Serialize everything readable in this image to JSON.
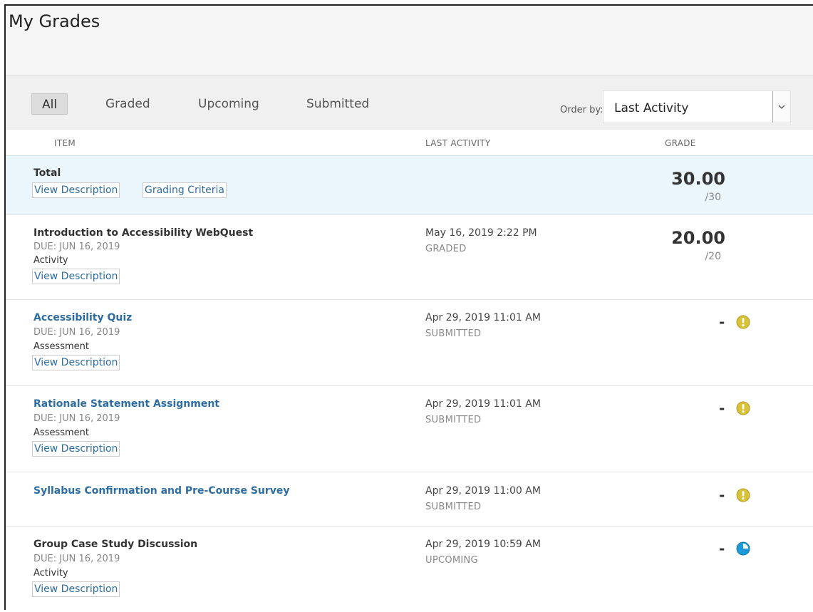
{
  "page": {
    "title": "My Grades"
  },
  "filters": {
    "all": "All",
    "graded": "Graded",
    "upcoming": "Upcoming",
    "submitted": "Submitted",
    "active": "All"
  },
  "order": {
    "label": "Order by:",
    "value": "Last Activity"
  },
  "columns": {
    "item": "ITEM",
    "last_activity": "LAST ACTIVITY",
    "grade": "GRADE"
  },
  "total": {
    "title": "Total",
    "view_description": "View Description",
    "grading_criteria": "Grading Criteria",
    "grade": "30.00",
    "points": "/30"
  },
  "items": [
    {
      "title": "Introduction to Accessibility WebQuest",
      "due": "DUE: JUN 16, 2019",
      "type": "Activity",
      "view_description": "View Description",
      "activity_date": "May 16, 2019 2:22 PM",
      "activity_status": "GRADED",
      "grade": "20.00",
      "points": "/20"
    },
    {
      "title": "Accessibility Quiz",
      "due": "DUE: JUN 16, 2019",
      "type": "Assessment",
      "view_description": "View Description",
      "activity_date": "Apr 29, 2019 11:01 AM",
      "activity_status": "SUBMITTED",
      "grade": "-",
      "status_icon": "needs-grading-icon"
    },
    {
      "title": "Rationale Statement Assignment",
      "due": "DUE: JUN 16, 2019",
      "type": "Assessment",
      "view_description": "View Description",
      "activity_date": "Apr 29, 2019 11:01 AM",
      "activity_status": "SUBMITTED",
      "grade": "-",
      "status_icon": "needs-grading-icon"
    },
    {
      "title": "Syllabus Confirmation and Pre-Course Survey",
      "activity_date": "Apr 29, 2019 11:00 AM",
      "activity_status": "SUBMITTED",
      "grade": "-",
      "status_icon": "needs-grading-icon"
    },
    {
      "title": "Group Case Study Discussion",
      "due": "DUE: JUN 16, 2019",
      "type": "Activity",
      "view_description": "View Description",
      "activity_date": "Apr 29, 2019 10:59 AM",
      "activity_status": "UPCOMING",
      "grade": "-",
      "status_icon": "in-progress-icon"
    }
  ],
  "colors": {
    "link": "#2d6da3",
    "total_bg": "#eaf6fb",
    "needs_grading": "#d9c13a",
    "in_progress": "#1e9ad6"
  }
}
